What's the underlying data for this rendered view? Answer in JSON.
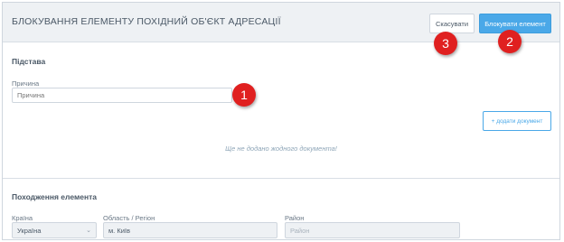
{
  "header": {
    "title": "БЛОКУВАННЯ ЕЛЕМЕНТУ ПОХІДНИЙ ОБ'ЄКТ АДРЕСАЦІЇ",
    "cancel_label": "Скасувати",
    "block_label": "Блокувати елемент"
  },
  "basis": {
    "section_title": "Підстава",
    "reason_label": "Причина",
    "reason_placeholder": "Причина",
    "reason_value": "",
    "add_document_label": "+ додати документ",
    "empty_message": "Ще не додано жодного документа!"
  },
  "origin": {
    "section_title": "Походження елемента",
    "country_label": "Країна",
    "country_value": "Україна",
    "region_label": "Область / Регіон",
    "region_value": "м. Київ",
    "district_label": "Район",
    "district_placeholder": "Район"
  },
  "annotations": {
    "badge_1": "1",
    "badge_2": "2",
    "badge_3": "3"
  },
  "colors": {
    "accent": "#4aa8e8",
    "header_bg": "#eef1f4",
    "badge": "#e02020"
  }
}
